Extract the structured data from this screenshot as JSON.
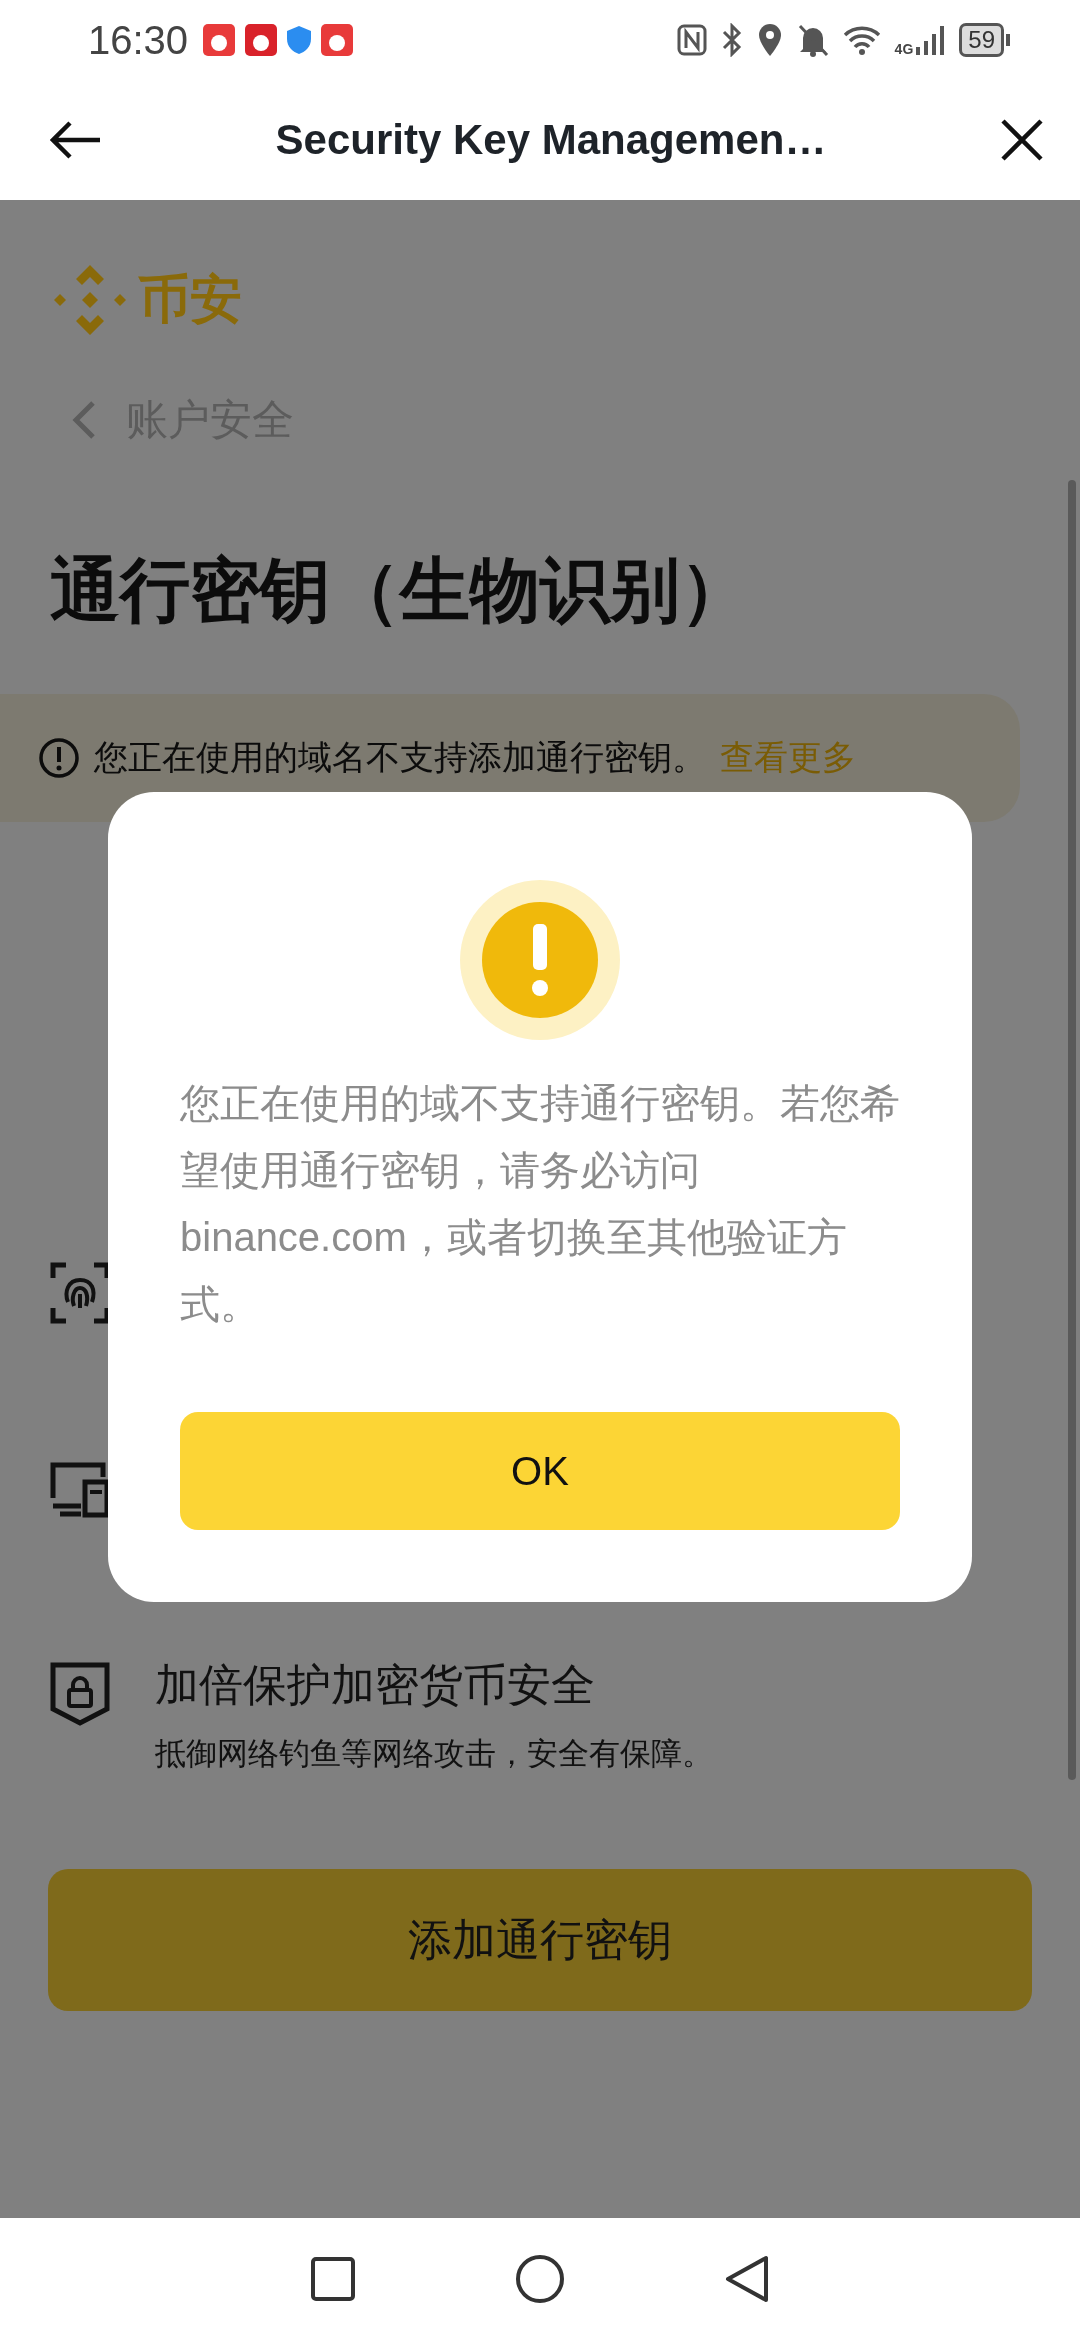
{
  "status_bar": {
    "time": "16:30",
    "network": "4G",
    "battery": "59"
  },
  "header": {
    "title": "Security Key Managemen…"
  },
  "page": {
    "logo_text": "币安",
    "breadcrumb": "账户安全",
    "title": "通行密钥（生物识别）",
    "notice": {
      "text": "您正在使用的域名不支持添加通行密钥。",
      "link": "查看更多"
    },
    "features": [
      {
        "kind": "fingerprint"
      },
      {
        "kind": "devices"
      },
      {
        "kind": "shield",
        "title": "加倍保护加密货币安全",
        "description": "抵御网络钓鱼等网络攻击，安全有保障。"
      }
    ],
    "add_button": "添加通行密钥"
  },
  "dialog": {
    "message": "您正在使用的域不支持通行密钥。若您希望使用通行密钥，请务必访问binance.com，或者切换至其他验证方式。",
    "button": "OK"
  }
}
